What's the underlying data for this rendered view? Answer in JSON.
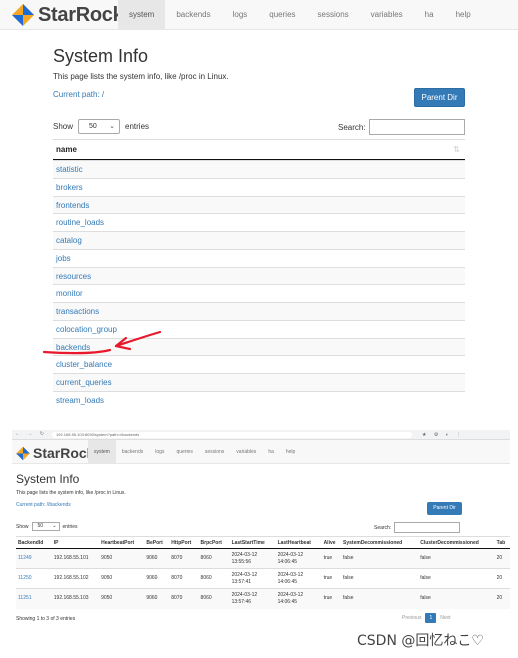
{
  "top": {
    "brand": "StarRocks",
    "nav": [
      "system",
      "backends",
      "logs",
      "queries",
      "sessions",
      "variables",
      "ha",
      "help"
    ],
    "active_nav": "system",
    "title": "System Info",
    "description": "This page lists the system info, like /proc in Linux.",
    "current_path": "Current path: /",
    "parent_dir": "Parent Dir",
    "show_label": "Show",
    "show_value": "50",
    "entries_label": "entries",
    "search_label": "Search:",
    "column_header": "name",
    "rows": [
      "statistic",
      "brokers",
      "frontends",
      "routine_loads",
      "catalog",
      "jobs",
      "resources",
      "monitor",
      "transactions",
      "colocation_group",
      "backends",
      "cluster_balance",
      "current_queries",
      "stream_loads"
    ]
  },
  "bottom": {
    "address": "192.168.55.103:8030/system?path=//backends",
    "brand": "StarRocks",
    "nav": [
      "system",
      "backends",
      "logs",
      "queries",
      "sessions",
      "variables",
      "ha",
      "help"
    ],
    "active_nav": "system",
    "title": "System Info",
    "description": "This page lists the system info, like /proc in Linux.",
    "current_path": "Current path: //backends",
    "parent_dir": "Parent Dir",
    "show_label": "Show",
    "show_value": "50",
    "entries_label": "entries",
    "search_label": "Search:",
    "columns": [
      "BackendId",
      "IP",
      "HeartbeatPort",
      "BePort",
      "HttpPort",
      "BrpcPort",
      "LastStartTime",
      "LastHeartbeat",
      "Alive",
      "SystemDecommissioned",
      "ClusterDecommissioned",
      "Tab"
    ],
    "rows": [
      [
        "11249",
        "192.168.55.101",
        "9050",
        "9060",
        "8070",
        "8060",
        "2024-03-12 13:55:56",
        "2024-03-12 14:06:45",
        "true",
        "false",
        "false",
        "20"
      ],
      [
        "11250",
        "192.168.55.102",
        "9050",
        "9060",
        "8070",
        "8060",
        "2024-03-12 13:57:41",
        "2024-03-12 14:06:45",
        "true",
        "false",
        "false",
        "20"
      ],
      [
        "11251",
        "192.168.55.103",
        "9050",
        "9060",
        "8070",
        "8060",
        "2024-03-12 13:57:46",
        "2024-03-12 14:06:45",
        "true",
        "false",
        "false",
        "20"
      ]
    ],
    "info": "Showing 1 to 3 of 3 entries",
    "pager": {
      "previous": "Previous",
      "current": "1",
      "next": "Next"
    }
  },
  "watermark": "CSDN @回忆ねこ♡",
  "colors": {
    "link": "#337ab7",
    "annotation": "#e8192c",
    "navbar": "#f8f8f8"
  }
}
